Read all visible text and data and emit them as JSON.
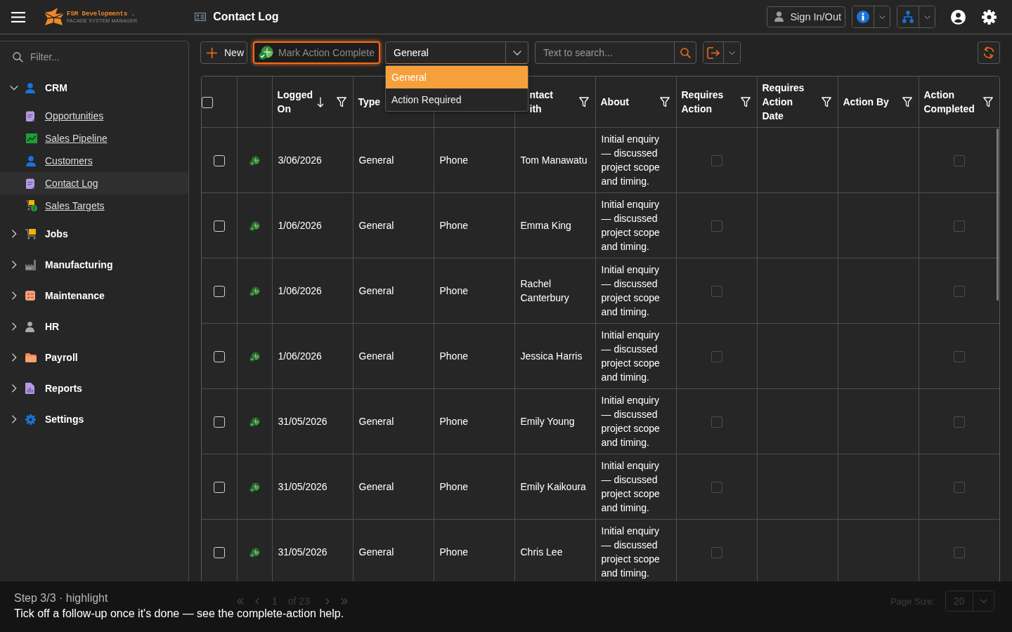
{
  "top_bar": {
    "logo": {
      "name": "FSM Developments .",
      "tagline": "FACADE SYSTEM MANAGER"
    },
    "title": "Contact Log",
    "sign_in_button": "Sign In/Out"
  },
  "sidebar": {
    "filter": {
      "placeholder": "Filter..."
    },
    "items": [
      {
        "label": "CRM",
        "expanded": true,
        "children": [
          {
            "label": "Opportunities",
            "selected": false
          },
          {
            "label": "Sales Pipeline",
            "selected": false
          },
          {
            "label": "Customers",
            "selected": false
          },
          {
            "label": "Contact Log",
            "selected": true
          },
          {
            "label": "Sales Targets",
            "selected": false
          }
        ]
      },
      {
        "label": "Jobs",
        "expanded": false
      },
      {
        "label": "Manufacturing",
        "expanded": false
      },
      {
        "label": "Maintenance",
        "expanded": false
      },
      {
        "label": "HR",
        "expanded": false
      },
      {
        "label": "Payroll",
        "expanded": false
      },
      {
        "label": "Reports",
        "expanded": false
      },
      {
        "label": "Settings",
        "expanded": false
      }
    ]
  },
  "toolbar": {
    "new_button": "New",
    "mark_complete_button": {
      "label": "Mark Action Complete",
      "disabled": true,
      "highlighted": true
    },
    "type_filter": {
      "value": "General",
      "expanded": true,
      "options": [
        {
          "label": "General",
          "selected": true
        },
        {
          "label": "Action Required",
          "selected": false
        }
      ]
    },
    "search": {
      "placeholder": "Text to search..."
    }
  },
  "table": {
    "select_all": false,
    "columns": [
      {
        "label": "Logged On",
        "kind": "text",
        "sorted": true,
        "filter": true,
        "clipped": false
      },
      {
        "label": "Type",
        "kind": "text",
        "sorted": false,
        "filter": false,
        "clipped": false
      },
      {
        "kind": "text"
      },
      {
        "label": "ntact ith",
        "kind": "text",
        "sorted": false,
        "filter": true,
        "clipped": true
      },
      {
        "label": "About",
        "kind": "text",
        "sorted": false,
        "filter": true,
        "clipped": false
      },
      {
        "label": "Requires Action",
        "kind": "check",
        "sorted": false,
        "filter": true,
        "clipped": false
      },
      {
        "label": "Requires Action Date",
        "kind": "text",
        "sorted": false,
        "filter": true,
        "clipped": false
      },
      {
        "label": "Action By",
        "kind": "text",
        "sorted": false,
        "filter": true,
        "clipped": false
      },
      {
        "label": "Action Completed",
        "kind": "check",
        "sorted": false,
        "filter": true,
        "clipped": false
      }
    ],
    "rows": [
      {
        "selected": false,
        "logged_on": "3/06/2026",
        "type": "General",
        "contact_method": "Phone",
        "contact_with": "Tom Manawatu",
        "about": "Initial enquiry — discussed project scope and timing.",
        "requires_action": false,
        "action_completed": false
      },
      {
        "selected": false,
        "logged_on": "1/06/2026",
        "type": "General",
        "contact_method": "Phone",
        "contact_with": "Emma King",
        "about": "Initial enquiry — discussed project scope and timing.",
        "requires_action": false,
        "action_completed": false
      },
      {
        "selected": false,
        "logged_on": "1/06/2026",
        "type": "General",
        "contact_method": "Phone",
        "contact_with": "Rachel Canterbury",
        "about": "Initial enquiry — discussed project scope and timing.",
        "requires_action": false,
        "action_completed": false
      },
      {
        "selected": false,
        "logged_on": "1/06/2026",
        "type": "General",
        "contact_method": "Phone",
        "contact_with": "Jessica Harris",
        "about": "Initial enquiry — discussed project scope and timing.",
        "requires_action": false,
        "action_completed": false
      },
      {
        "selected": false,
        "logged_on": "31/05/2026",
        "type": "General",
        "contact_method": "Phone",
        "contact_with": "Emily Young",
        "about": "Initial enquiry — discussed project scope and timing.",
        "requires_action": false,
        "action_completed": false
      },
      {
        "selected": false,
        "logged_on": "31/05/2026",
        "type": "General",
        "contact_method": "Phone",
        "contact_with": "Emily Kaikoura",
        "about": "Initial enquiry — discussed project scope and timing.",
        "requires_action": false,
        "action_completed": false
      },
      {
        "selected": false,
        "logged_on": "31/05/2026",
        "type": "General",
        "contact_method": "Phone",
        "contact_with": "Chris Lee",
        "about": "Initial enquiry — discussed project scope and timing.",
        "requires_action": false,
        "action_completed": false
      }
    ]
  },
  "pager": {
    "page": "1",
    "page_count": "of 23",
    "page_size_label": "Page Size:",
    "page_size": "20"
  },
  "tour": {
    "step": "Step 3/3 · highlight",
    "message": "Tick off a follow-up once it's done — see the complete-action help."
  }
}
